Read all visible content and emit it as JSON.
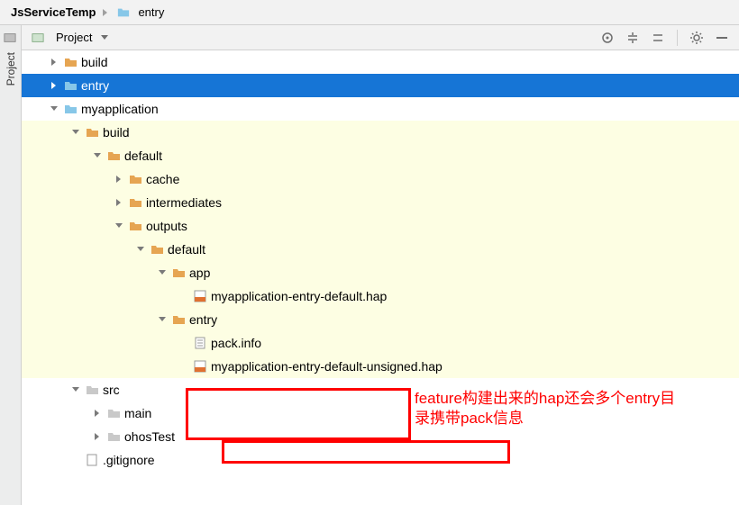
{
  "breadcrumb": {
    "root": "JsServiceTemp",
    "child": "entry"
  },
  "sidebar": {
    "tab_label": "Project"
  },
  "panel": {
    "title": "Project"
  },
  "tree": {
    "n0": "build",
    "n1": "entry",
    "n2": "myapplication",
    "n3": "build",
    "n4": "default",
    "n5": "cache",
    "n6": "intermediates",
    "n7": "outputs",
    "n8": "default",
    "n9": "app",
    "n10": "myapplication-entry-default.hap",
    "n11": "entry",
    "n12": "pack.info",
    "n13": "myapplication-entry-default-unsigned.hap",
    "n14": "src",
    "n15": "main",
    "n16": "ohosTest",
    "n17": ".gitignore"
  },
  "annotation": "feature构建出来的hap还会多个entry目录携带pack信息"
}
